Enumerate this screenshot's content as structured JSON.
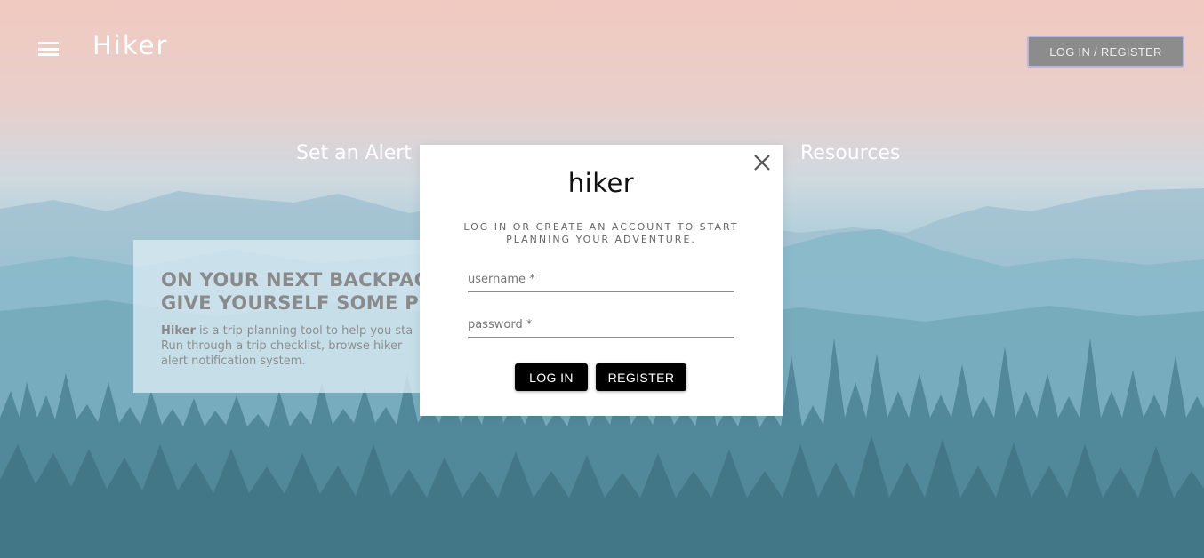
{
  "header": {
    "menu_icon": "hamburger-menu-icon",
    "brand": "Hiker",
    "login_register_label": "LOG IN / REGISTER"
  },
  "nav": {
    "alert_label": "Set an Alert",
    "resources_label": "Resources"
  },
  "hero": {
    "title_line1": "ON YOUR NEXT BACKPAC",
    "title_line2": "GIVE YOURSELF SOME PE",
    "body_brand": "Hiker",
    "body_line1_rest": " is a trip-planning tool to help you sta",
    "body_line2": "Run through a trip checklist, browse hiker",
    "body_line3": "alert notification system."
  },
  "modal": {
    "close_icon": "close-icon",
    "logo": "hiker",
    "tagline": "LOG IN OR CREATE AN ACCOUNT TO START PLANNING YOUR ADVENTURE.",
    "username_label": "username *",
    "username_value": "",
    "password_label": "password *",
    "password_value": "",
    "login_label": "LOG IN",
    "register_label": "REGISTER"
  },
  "colors": {
    "modal_bg": "#ffffff",
    "button_bg": "#000000",
    "top_button_bg": "#8c8c8c",
    "top_button_border": "#b9b6dd"
  }
}
